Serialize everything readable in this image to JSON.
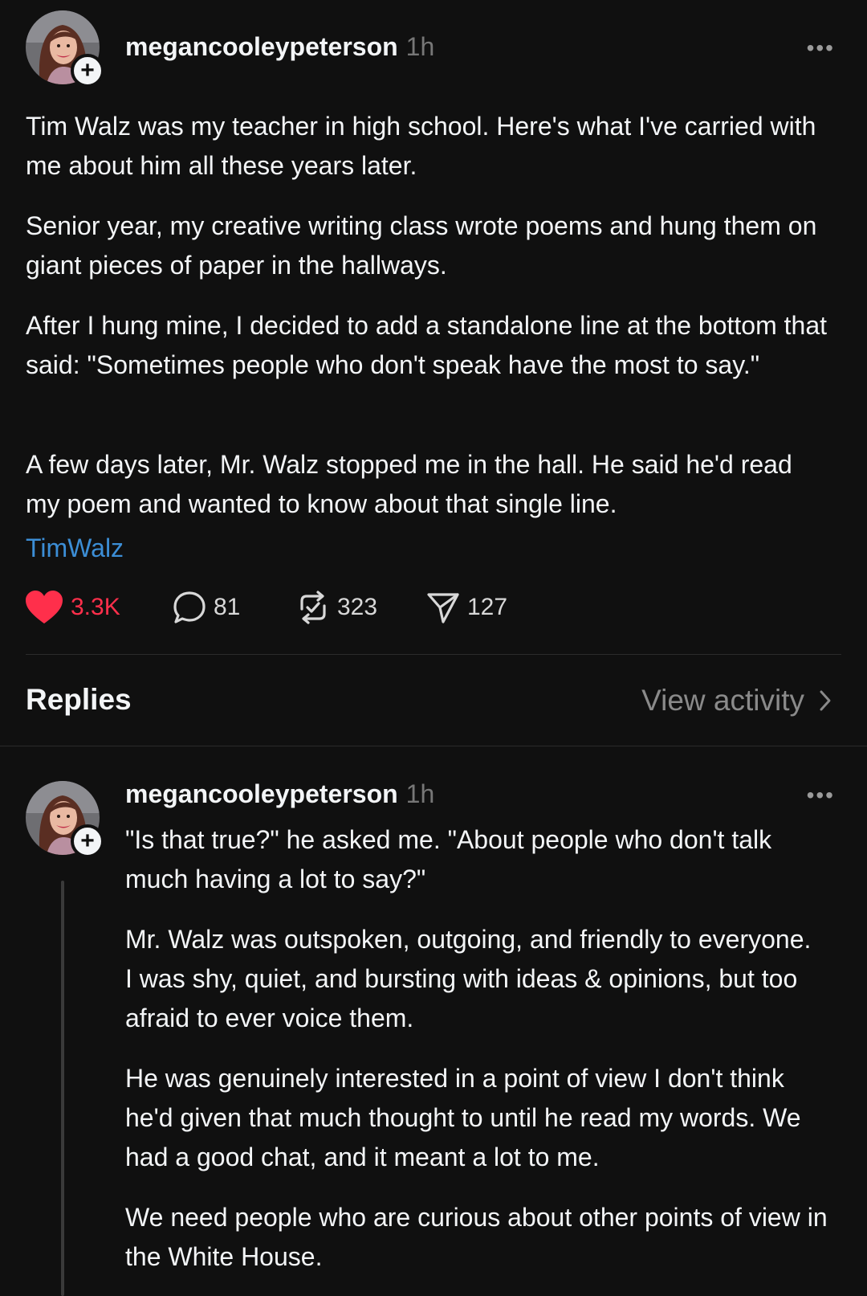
{
  "post": {
    "username": "megancooleypeterson",
    "time": "1h",
    "more": "•••",
    "paragraphs": [
      "Tim Walz was my teacher in high school. Here's what I've carried with me about him all these years later.",
      "Senior year, my creative writing class wrote poems and hung them on giant pieces of paper in the hallways.",
      "After I hung mine, I decided to add a standalone line at the bottom that said: \"Sometimes people who don't speak have the most to say.\"",
      "A few days later, Mr. Walz stopped me in the hall. He said he'd read my poem and wanted to know about that single line."
    ],
    "tag": "TimWalz",
    "likes": "3.3K",
    "replies_count": "81",
    "reposts": "323",
    "shares": "127",
    "like_icon": "heart-filled-icon",
    "reply_icon": "speech-bubble-icon",
    "repost_icon": "repost-icon",
    "share_icon": "send-icon",
    "accent_like": "#ff2f4b",
    "accent_tag": "#3c8ed6"
  },
  "replies_header": {
    "title": "Replies",
    "view_activity": "View activity",
    "chevron": "›"
  },
  "reply": {
    "username": "megancooleypeterson",
    "time": "1h",
    "more": "•••",
    "paragraphs": [
      "\"Is that true?\" he asked me. \"About people who don't talk much having a lot to say?\"",
      "Mr. Walz was outspoken, outgoing, and friendly to everyone. I was shy, quiet, and bursting with ideas & opinions, but too afraid to ever voice them.",
      "He was genuinely interested in a point of view I don't think he'd given that much thought to until he read my words. We had a good chat, and it meant a lot to me.",
      "We need people who are curious about other points of view in the White House."
    ]
  }
}
